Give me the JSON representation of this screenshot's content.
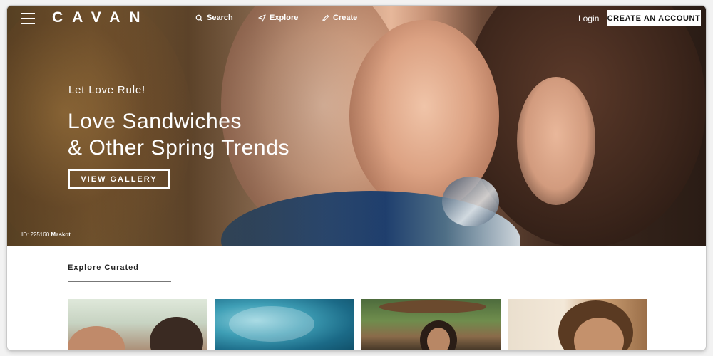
{
  "nav": {
    "logo": "CAVAN",
    "search": "Search",
    "explore": "Explore",
    "create": "Create",
    "login": "Login",
    "cta": "CREATE AN ACCOUNT"
  },
  "hero": {
    "eyebrow": "Let Love Rule!",
    "headline_line1": "Love Sandwiches",
    "headline_line2": "& Other Spring Trends",
    "button": "VIEW GALLERY",
    "image_id": "ID: 225160",
    "image_credit": "Maskot"
  },
  "curated": {
    "title": "Explore Curated"
  },
  "icons": {
    "menu": "hamburger-menu-icon",
    "search": "magnifier-icon",
    "explore": "compass-arrow-icon",
    "create": "pencil-icon"
  },
  "colors": {
    "cta_bg": "#ffffff",
    "text_on_hero": "#ffffff"
  }
}
